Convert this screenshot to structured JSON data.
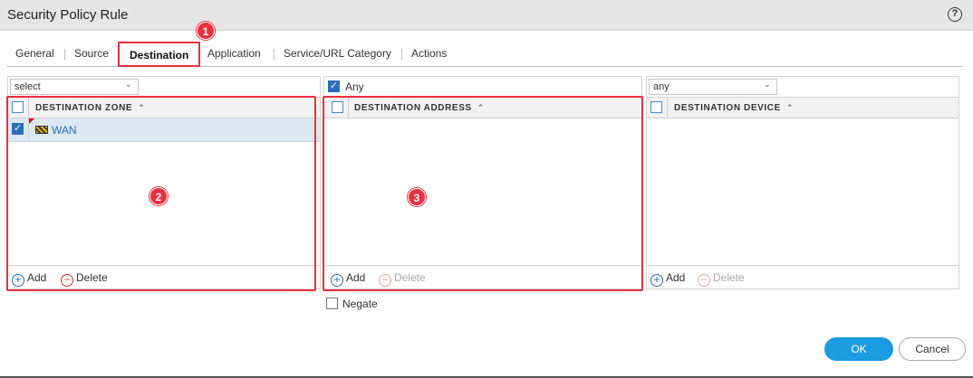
{
  "dialog": {
    "title": "Security Policy Rule",
    "help": "?"
  },
  "tabs": [
    "General",
    "Source",
    "Destination",
    "Application",
    "Service/URL Category",
    "Actions"
  ],
  "active_tab": "Destination",
  "annotations": [
    "1",
    "2",
    "3"
  ],
  "zone_panel": {
    "select_value": "select",
    "column_header": "DESTINATION ZONE",
    "rows": [
      {
        "label": "WAN",
        "checked": true
      }
    ],
    "add_label": "Add",
    "delete_label": "Delete"
  },
  "address_panel": {
    "any_label": "Any",
    "any_checked": true,
    "column_header": "DESTINATION ADDRESS",
    "add_label": "Add",
    "delete_label": "Delete",
    "negate_label": "Negate"
  },
  "device_panel": {
    "select_value": "any",
    "column_header": "DESTINATION DEVICE",
    "add_label": "Add",
    "delete_label": "Delete"
  },
  "buttons": {
    "ok": "OK",
    "cancel": "Cancel"
  },
  "colors": {
    "accent": "#1b9be0",
    "highlight": "#e8313f",
    "selected_row": "#dce8f2"
  }
}
